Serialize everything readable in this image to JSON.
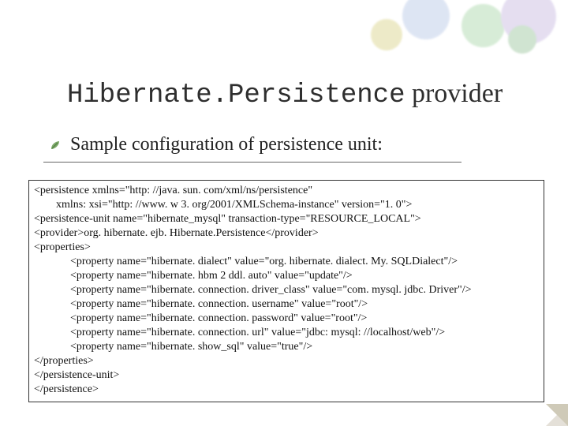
{
  "title": {
    "mono_part": "Hibernate.Persistence",
    "serif_part": " provider"
  },
  "subtitle": "Sample configuration of persistence unit:",
  "bullet_icon": "leaf-icon",
  "code_lines": [
    {
      "cls": "",
      "text": "<persistence xmlns=\"http: //java. sun. com/xml/ns/persistence\""
    },
    {
      "cls": "ind1",
      "text": "xmlns: xsi=\"http: //www. w 3. org/2001/XMLSchema-instance\" version=\"1. 0\">"
    },
    {
      "cls": "",
      "text": "<persistence-unit name=\"hibernate_mysql\" transaction-type=\"RESOURCE_LOCAL\">"
    },
    {
      "cls": "",
      "text": "<provider>org. hibernate. ejb. Hibernate.Persistence</provider>"
    },
    {
      "cls": "",
      "text": "<properties>"
    },
    {
      "cls": "ind2",
      "text": "<property name=\"hibernate. dialect\" value=\"org. hibernate. dialect. My. SQLDialect\"/>"
    },
    {
      "cls": "ind2",
      "text": "<property name=\"hibernate. hbm 2 ddl. auto\" value=\"update\"/>"
    },
    {
      "cls": "ind2",
      "text": "<property name=\"hibernate. connection. driver_class\" value=\"com. mysql. jdbc. Driver\"/>"
    },
    {
      "cls": "ind2",
      "text": "<property name=\"hibernate. connection. username\" value=\"root\"/>"
    },
    {
      "cls": "ind2",
      "text": "<property name=\"hibernate. connection. password\" value=\"root\"/>"
    },
    {
      "cls": "ind2",
      "text": "<property name=\"hibernate. connection. url\" value=\"jdbc: mysql: //localhost/web\"/>"
    },
    {
      "cls": "ind2",
      "text": "<property name=\"hibernate. show_sql\" value=\"true\"/>"
    },
    {
      "cls": "",
      "text": "</properties>"
    },
    {
      "cls": "",
      "text": "</persistence-unit>"
    },
    {
      "cls": "",
      "text": "</persistence>"
    }
  ]
}
